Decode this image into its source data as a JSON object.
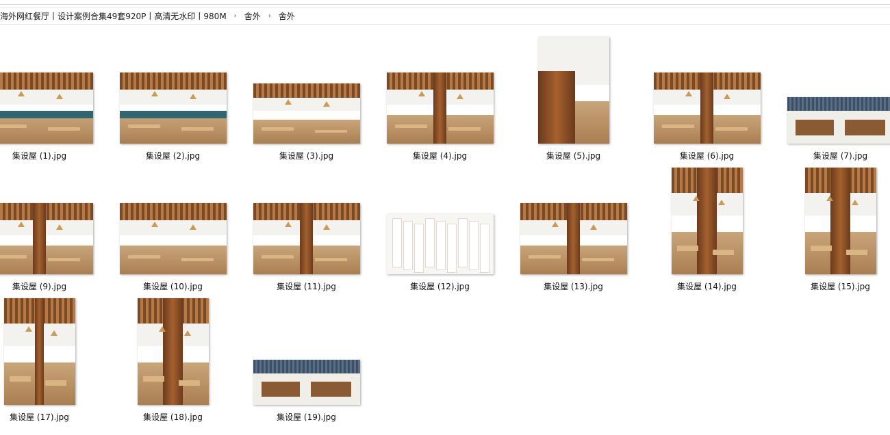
{
  "breadcrumb": [
    "海外网红餐厅丨设计案例合集49套920P丨高清无水印丨980M",
    "舍外",
    "舍外"
  ],
  "files": [
    {
      "name": "集设屋 (1).jpg",
      "orientation": "landscape",
      "scene": "cafe-bench"
    },
    {
      "name": "集设屋 (2).jpg",
      "orientation": "landscape",
      "scene": "cafe-bench"
    },
    {
      "name": "集设屋 (3).jpg",
      "orientation": "landscape",
      "scene": "hall"
    },
    {
      "name": "集设屋 (4).jpg",
      "orientation": "landscape",
      "scene": "tree"
    },
    {
      "name": "集设屋 (5).jpg",
      "orientation": "portrait",
      "scene": "cabinet"
    },
    {
      "name": "集设屋 (6).jpg",
      "orientation": "landscape",
      "scene": "tree"
    },
    {
      "name": "集设屋 (7).jpg",
      "orientation": "landscape",
      "scene": "storefront"
    },
    {
      "name": "集设屋 (9).jpg",
      "orientation": "landscape",
      "scene": "tree"
    },
    {
      "name": "集设屋 (10).jpg",
      "orientation": "landscape",
      "scene": "hall"
    },
    {
      "name": "集设屋 (11).jpg",
      "orientation": "landscape",
      "scene": "tree"
    },
    {
      "name": "集设屋 (12).jpg",
      "orientation": "landscape",
      "scene": "cards"
    },
    {
      "name": "集设屋 (13).jpg",
      "orientation": "landscape",
      "scene": "tree"
    },
    {
      "name": "集设屋 (14).jpg",
      "orientation": "portrait",
      "scene": "column"
    },
    {
      "name": "集设屋 (15).jpg",
      "orientation": "portrait",
      "scene": "column"
    },
    {
      "name": "集设屋 (17).jpg",
      "orientation": "portrait",
      "scene": "tree"
    },
    {
      "name": "集设屋 (18).jpg",
      "orientation": "portrait",
      "scene": "column"
    },
    {
      "name": "集设屋 (19).jpg",
      "orientation": "landscape",
      "scene": "storefront"
    }
  ]
}
